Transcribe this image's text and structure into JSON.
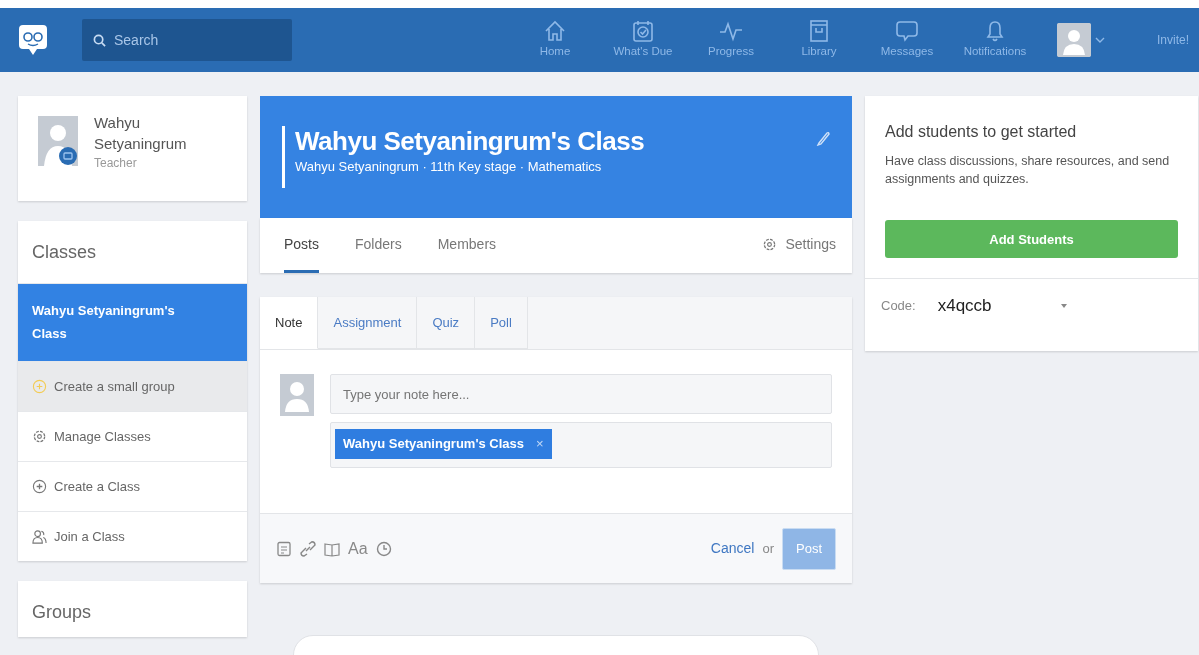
{
  "navbar": {
    "search": {
      "placeholder": "Search"
    },
    "items": [
      {
        "kind": "home",
        "label": "Home"
      },
      {
        "kind": "due",
        "label": "What's Due"
      },
      {
        "kind": "progress",
        "label": "Progress"
      },
      {
        "kind": "library",
        "label": "Library"
      },
      {
        "kind": "messages",
        "label": "Messages"
      },
      {
        "kind": "notifications",
        "label": "Notifications"
      }
    ],
    "invite": "Invite!"
  },
  "profile": {
    "name": "Wahyu Setyaningrum",
    "role": "Teacher"
  },
  "classes": {
    "title": "Classes",
    "items": [
      {
        "kind": "class",
        "label": "Wahyu Setyaningrum's Class",
        "selected": true
      },
      {
        "kind": "small-group",
        "label": "Create a small group",
        "selected": false
      },
      {
        "kind": "manage",
        "label": "Manage Classes",
        "selected": false
      },
      {
        "kind": "create",
        "label": "Create a Class",
        "selected": false
      },
      {
        "kind": "join",
        "label": "Join a Class",
        "selected": false
      }
    ]
  },
  "groups": {
    "title": "Groups"
  },
  "class_header": {
    "title": "Wahyu Setyaningrum's Class",
    "subtitle": "Wahyu Setyaningrum · 11th Key stage · Mathematics"
  },
  "class_tabs": [
    {
      "label": "Posts",
      "selected": true
    },
    {
      "label": "Folders",
      "selected": false
    },
    {
      "label": "Members",
      "selected": false
    }
  ],
  "settings": "Settings",
  "composer": {
    "tabs": [
      {
        "label": "Note",
        "selected": true
      },
      {
        "label": "Assignment",
        "selected": false
      },
      {
        "label": "Quiz",
        "selected": false
      },
      {
        "label": "Poll",
        "selected": false
      }
    ],
    "placeholder": "Type your note here...",
    "recipient": "Wahyu Setyaningrum's Class",
    "remove": "×",
    "format": "Aa",
    "cancel": "Cancel",
    "or": "or",
    "post": {
      "label": "Post",
      "disabled": true
    }
  },
  "get_started": {
    "title": "Add students to get started",
    "text": "Have class discussions, share resources, and send assignments and quizzes.",
    "button": "Add Students",
    "code_label": "Code:",
    "code": "x4qccb"
  }
}
